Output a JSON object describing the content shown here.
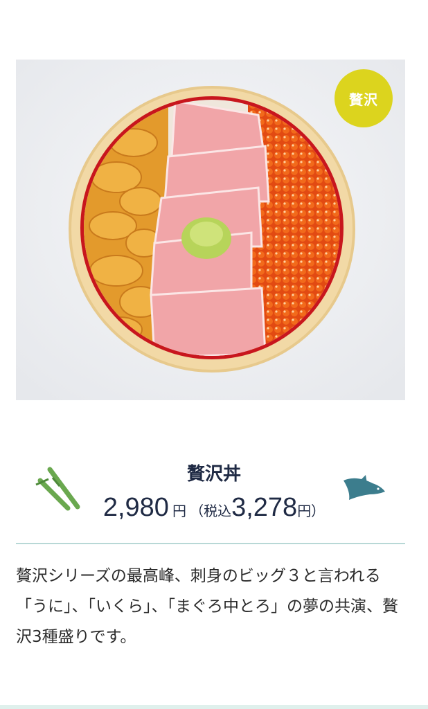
{
  "product": {
    "badge": "贅沢",
    "name": "贅沢丼",
    "price": "2,980",
    "yen": "円",
    "tax_prefix": "（税込",
    "tax_price": "3,278",
    "tax_suffix": "円）",
    "description": "贅沢シリーズの最高峰、刺身のビッグ３と言われる「うに」、「いくら」、「まぐろ中とろ」の夢の共演、贅沢3種盛りです。"
  },
  "colors": {
    "badge": "#dcd41e",
    "title": "#1f2a44",
    "divider": "#b8d8d6",
    "bowl_rim": "#f2d9a6",
    "bowl_inner": "#c8161d",
    "herb": "#6aa84f",
    "fish": "#3c7d8d"
  },
  "icons": {
    "herb": "green-onion-icon",
    "fish": "fish-icon"
  }
}
